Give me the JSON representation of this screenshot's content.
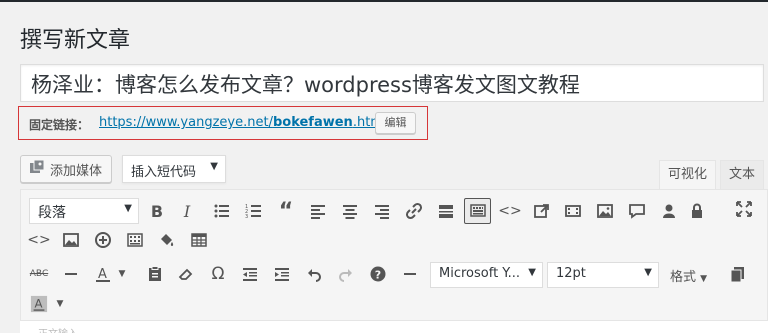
{
  "page": {
    "title": "撰写新文章"
  },
  "post": {
    "title": "杨泽业：博客怎么发布文章？wordpress博客发文图文教程"
  },
  "permalink": {
    "label": "固定链接：",
    "url_prefix": "https://www.yangzeye.net/",
    "slug": "bokefawen",
    "url_suffix": ".html",
    "edit_label": "编辑"
  },
  "media": {
    "add_label": "添加媒体"
  },
  "shortcode": {
    "label": "插入短代码"
  },
  "tabs": {
    "visual": "可视化",
    "text": "文本"
  },
  "toolbar": {
    "format_select": "段落",
    "font_family": "Microsoft Y...",
    "font_size": "12pt",
    "formats_label": "格式"
  },
  "content": {
    "hint": "正文输入..."
  },
  "colors": {
    "permalink_border": "#d63638",
    "link": "#0073aa",
    "icon": "#555555"
  }
}
